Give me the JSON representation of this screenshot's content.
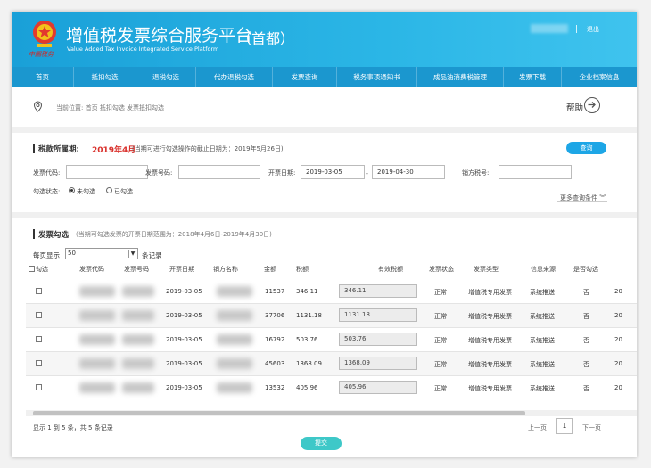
{
  "header": {
    "emblem_caption": "中国税务",
    "title": "增值税发票综合服务平台",
    "subtitle": "Value Added Tax Invoice Integrated Service Platform",
    "region": "（首都）",
    "logout": "退出"
  },
  "nav": {
    "items": [
      {
        "label": "首页"
      },
      {
        "label": "抵扣勾选"
      },
      {
        "label": "退税勾选"
      },
      {
        "label": "代办退税勾选"
      },
      {
        "label": "发票查询"
      },
      {
        "label": "税务事项通知书"
      },
      {
        "label": "成品油消费税管理"
      },
      {
        "label": "发票下载"
      },
      {
        "label": "企业档案信息"
      }
    ]
  },
  "breadcrumb": {
    "label": "当前位置:",
    "path": "首页  抵扣勾选  发票抵扣勾选",
    "help": "帮助"
  },
  "filter": {
    "period_label": "税款所属期:",
    "period_value": "2019年4月",
    "period_note": "(当期可进行勾选操作的截止日期为：2019年5月26日)",
    "query_button": "查询",
    "invoice_code_label": "发票代码:",
    "invoice_number_label": "发票号码:",
    "issue_date_label": "开票日期:",
    "date_from": "2019-03-05",
    "date_to": "2019-04-30",
    "date_separator": "-",
    "seller_tax_label": "销方税号:",
    "status_label": "勾选状态:",
    "status_options": [
      "未勾选",
      "已勾选"
    ],
    "status_selected": "未勾选",
    "more_conditions": "更多查询条件 ︾"
  },
  "invoice_section": {
    "title": "发票勾选",
    "note": "(当期可勾选发票的开票日期范围为：2018年4月6日-2019年4月30日)",
    "page_size_label": "每页显示",
    "page_size": "50",
    "page_size_unit": "条记录",
    "columns": [
      "勾选",
      "发票代码",
      "发票号码",
      "开票日期",
      "销方名称",
      "金额",
      "税额",
      "有效税额",
      "发票状态",
      "发票类型",
      "信息来源",
      "是否勾选"
    ],
    "rows": [
      {
        "date": "2019-03-05",
        "amount": "11537",
        "tax": "346.11",
        "valid_tax": "346.11",
        "status": "正常",
        "type": "增值税专用发票",
        "source": "系统推送",
        "checked": "否",
        "extra": "20"
      },
      {
        "date": "2019-03-05",
        "amount": "37706",
        "tax": "1131.18",
        "valid_tax": "1131.18",
        "status": "正常",
        "type": "增值税专用发票",
        "source": "系统推送",
        "checked": "否",
        "extra": "20"
      },
      {
        "date": "2019-03-05",
        "amount": "16792",
        "tax": "503.76",
        "valid_tax": "503.76",
        "status": "正常",
        "type": "增值税专用发票",
        "source": "系统推送",
        "checked": "否",
        "extra": "20"
      },
      {
        "date": "2019-03-05",
        "amount": "45603",
        "tax": "1368.09",
        "valid_tax": "1368.09",
        "status": "正常",
        "type": "增值税专用发票",
        "source": "系统推送",
        "checked": "否",
        "extra": "20"
      },
      {
        "date": "2019-03-05",
        "amount": "13532",
        "tax": "405.96",
        "valid_tax": "405.96",
        "status": "正常",
        "type": "增值税专用发票",
        "source": "系统推送",
        "checked": "否",
        "extra": "20"
      }
    ],
    "summary": "显示 1 到 5 条，共 5 条记录",
    "prev": "上一页",
    "current_page": "1",
    "next": "下一页",
    "submit": "提交"
  },
  "colors": {
    "header_start": "#1aa0d8",
    "nav": "#1b97cf",
    "period_red": "#d9302b",
    "query_button": "#1da6e6",
    "submit_button": "#3ec8c8"
  }
}
